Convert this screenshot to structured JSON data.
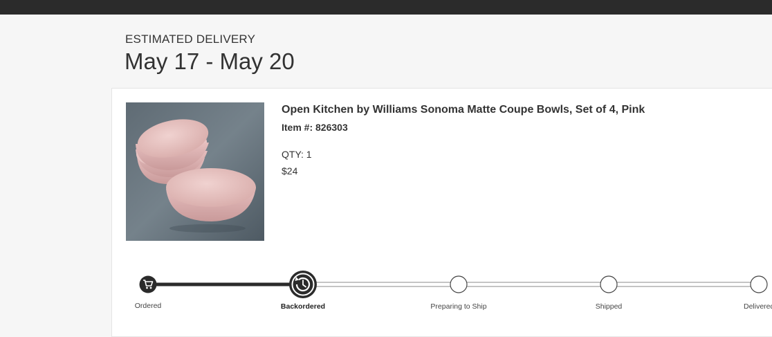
{
  "delivery": {
    "label": "ESTIMATED DELIVERY",
    "date_range": "May 17 - May 20"
  },
  "item": {
    "title": "Open Kitchen by Williams Sonoma Matte Coupe Bowls, Set of 4, Pink",
    "item_number": "Item #: 826303",
    "qty": "QTY: 1",
    "price": "$24",
    "image_icon": "pink-bowls-product-image"
  },
  "tracker": {
    "current_step": 1,
    "steps": [
      {
        "label": "Ordered",
        "status": "complete",
        "icon": "cart-icon"
      },
      {
        "label": "Backordered",
        "status": "current",
        "icon": "clock-refresh-icon"
      },
      {
        "label": "Preparing to Ship",
        "status": "pending",
        "icon": "empty-circle"
      },
      {
        "label": "Shipped",
        "status": "pending",
        "icon": "empty-circle"
      },
      {
        "label": "Delivered",
        "status": "pending",
        "icon": "empty-circle"
      }
    ]
  },
  "colors": {
    "active": "#2b2b2b",
    "pending_track": "#888888",
    "background": "#f6f6f6"
  }
}
